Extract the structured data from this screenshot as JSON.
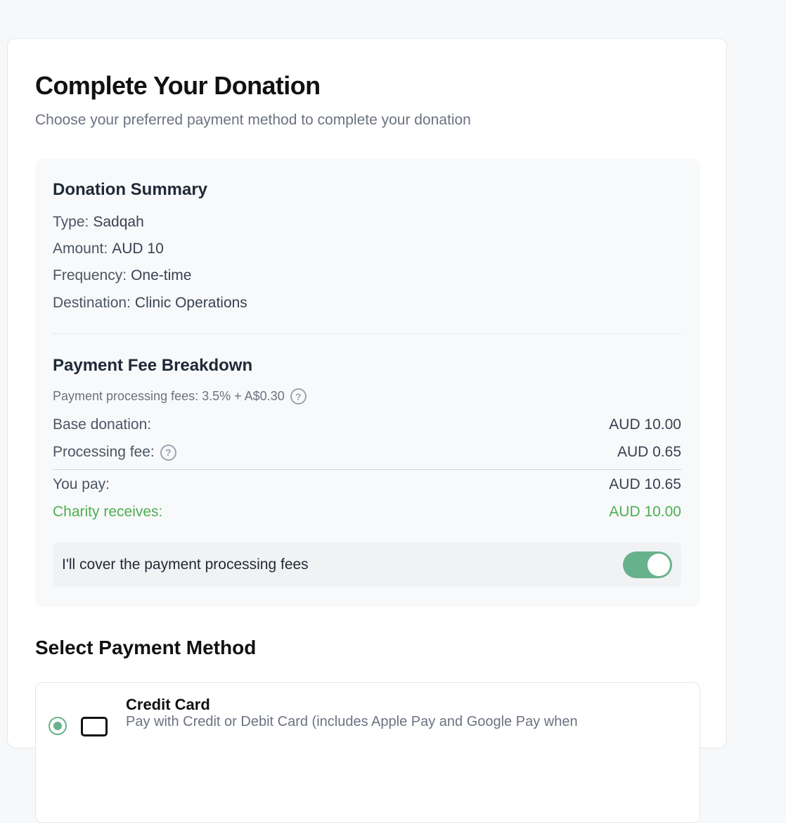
{
  "header": {
    "title": "Complete Your Donation",
    "subtitle": "Choose your preferred payment method to complete your donation"
  },
  "summary": {
    "title": "Donation Summary",
    "type_label": "Type:",
    "type_value": "Sadqah",
    "amount_label": "Amount:",
    "amount_value": "AUD 10",
    "frequency_label": "Frequency:",
    "frequency_value": "One-time",
    "destination_label": "Destination:",
    "destination_value": "Clinic Operations"
  },
  "fees": {
    "title": "Payment Fee Breakdown",
    "note": "Payment processing fees: 3.5% + A$0.30",
    "help_glyph": "?",
    "base_label": "Base donation:",
    "base_value": "AUD 10.00",
    "processing_label": "Processing fee:",
    "processing_value": "AUD 0.65",
    "you_pay_label": "You pay:",
    "you_pay_value": "AUD 10.65",
    "charity_label": "Charity receives:",
    "charity_value": "AUD 10.00",
    "charity_color": "#4caf50"
  },
  "cover_fees": {
    "label": "I'll cover the payment processing fees",
    "enabled": true,
    "toggle_color": "#67b28c"
  },
  "payment": {
    "title": "Select Payment Method",
    "methods": [
      {
        "name": "Credit Card",
        "description": "Pay with Credit or Debit Card (includes Apple Pay and Google Pay when",
        "icon": "credit-card-icon",
        "selected": true
      }
    ]
  }
}
